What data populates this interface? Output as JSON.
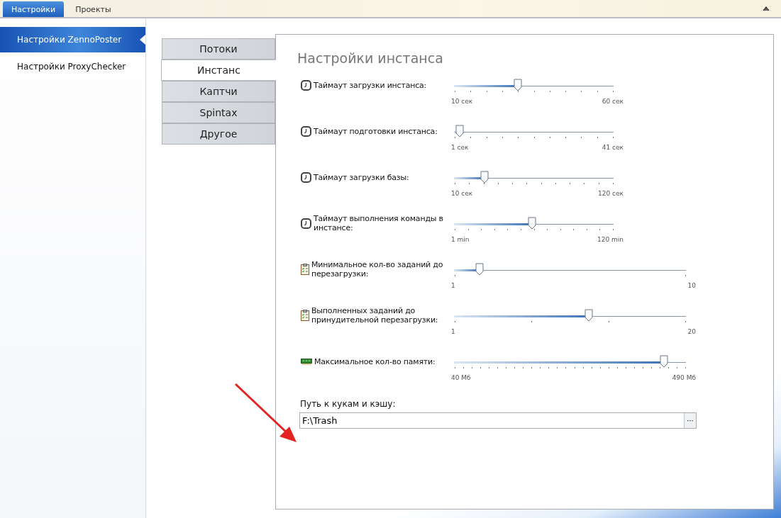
{
  "top_tabs": [
    {
      "label": "Настройки",
      "selected": true
    },
    {
      "label": "Проекты",
      "selected": false
    }
  ],
  "sidebar": {
    "items": [
      {
        "label": "Настройки ZennoPoster",
        "selected": true
      },
      {
        "label": "Настройки ProxyChecker",
        "selected": false
      }
    ]
  },
  "section_tabs": [
    {
      "label": "Потоки",
      "selected": false
    },
    {
      "label": "Инстанс",
      "selected": true
    },
    {
      "label": "Каптчи",
      "selected": false
    },
    {
      "label": "Spintax",
      "selected": false
    },
    {
      "label": "Другое",
      "selected": false
    }
  ],
  "panel": {
    "title": "Настройки инстанса",
    "settings": [
      {
        "kind": "clock",
        "label": "Таймаут загрузки инстанса:",
        "level": 0.4,
        "min": "10 сек",
        "max": "60 сек",
        "wide": false
      },
      {
        "kind": "clock",
        "label": "Таймаут подготовки инстанса:",
        "level": 0.035,
        "min": "1 сек",
        "max": "41 сек",
        "wide": false
      },
      {
        "kind": "clock",
        "label": "Таймаут загрузки базы:",
        "level": 0.19,
        "min": "10 сек",
        "max": "120 сек",
        "wide": false
      },
      {
        "kind": "clock",
        "label": "Таймаут выполнения команды в инстансе:",
        "level": 0.49,
        "min": "1 min",
        "max": "120 min",
        "wide": false
      },
      {
        "kind": "clipboard",
        "label": "Минимальное кол-во заданий до перезагрузки:",
        "level": 0.11,
        "min": "1",
        "max": "10",
        "wide": true
      },
      {
        "kind": "clipboard",
        "label": "Выполненных заданий до принудительной перезагрузки:",
        "level": 0.58,
        "min": "1",
        "max": "20",
        "wide": true
      },
      {
        "kind": "memory",
        "label": "Максимальное кол-во памяти:",
        "level": 0.905,
        "min": "40 Мб",
        "max": "490 Мб",
        "wide": true
      }
    ],
    "path": {
      "label": "Путь к кукам и кэшу:",
      "value": "F:\\Trash",
      "button": "···"
    }
  }
}
